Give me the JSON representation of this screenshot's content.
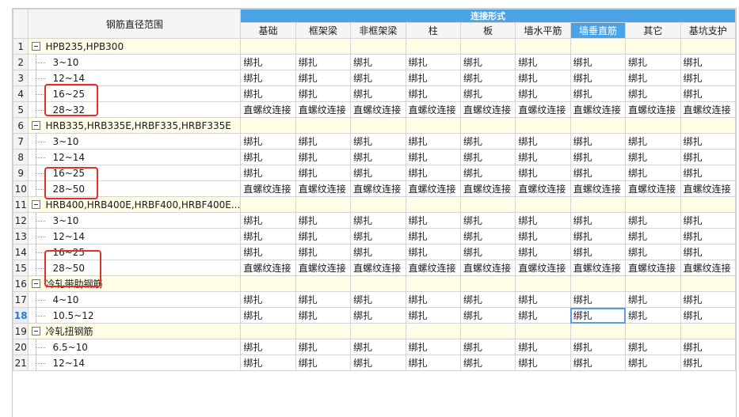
{
  "header": {
    "range_label": "钢筋直径范围",
    "group_label": "连接形式",
    "columns": [
      "基础",
      "框架梁",
      "非框架梁",
      "柱",
      "板",
      "墙水平筋",
      "墙垂直筋",
      "其它",
      "基坑支护"
    ],
    "active_column": "墙垂直筋"
  },
  "rows": [
    {
      "n": "1",
      "type": "group",
      "label": "HPB235,HPB300",
      "vals": [
        "",
        "",
        "",
        "",
        "",
        "",
        "",
        "",
        ""
      ]
    },
    {
      "n": "2",
      "type": "child",
      "label": "3~10",
      "vals": [
        "绑扎",
        "绑扎",
        "绑扎",
        "绑扎",
        "绑扎",
        "绑扎",
        "绑扎",
        "绑扎",
        "绑扎"
      ]
    },
    {
      "n": "3",
      "type": "child",
      "label": "12~14",
      "vals": [
        "绑扎",
        "绑扎",
        "绑扎",
        "绑扎",
        "绑扎",
        "绑扎",
        "绑扎",
        "绑扎",
        "绑扎"
      ]
    },
    {
      "n": "4",
      "type": "child",
      "label": "16~25",
      "vals": [
        "绑扎",
        "绑扎",
        "绑扎",
        "绑扎",
        "绑扎",
        "绑扎",
        "绑扎",
        "绑扎",
        "绑扎"
      ]
    },
    {
      "n": "5",
      "type": "child",
      "label": "28~32",
      "vals": [
        "直螺纹连接",
        "直螺纹连接",
        "直螺纹连接",
        "直螺纹连接",
        "直螺纹连接",
        "直螺纹连接",
        "直螺纹连接",
        "直螺纹连接",
        "直螺纹连接"
      ]
    },
    {
      "n": "6",
      "type": "group",
      "label": "HRB335,HRB335E,HRBF335,HRBF335E",
      "vals": [
        "",
        "",
        "",
        "",
        "",
        "",
        "",
        "",
        ""
      ]
    },
    {
      "n": "7",
      "type": "child",
      "label": "3~10",
      "vals": [
        "绑扎",
        "绑扎",
        "绑扎",
        "绑扎",
        "绑扎",
        "绑扎",
        "绑扎",
        "绑扎",
        "绑扎"
      ]
    },
    {
      "n": "8",
      "type": "child",
      "label": "12~14",
      "vals": [
        "绑扎",
        "绑扎",
        "绑扎",
        "绑扎",
        "绑扎",
        "绑扎",
        "绑扎",
        "绑扎",
        "绑扎"
      ]
    },
    {
      "n": "9",
      "type": "child",
      "label": "16~25",
      "vals": [
        "绑扎",
        "绑扎",
        "绑扎",
        "绑扎",
        "绑扎",
        "绑扎",
        "绑扎",
        "绑扎",
        "绑扎"
      ]
    },
    {
      "n": "10",
      "type": "child",
      "label": "28~50",
      "vals": [
        "直螺纹连接",
        "直螺纹连接",
        "直螺纹连接",
        "直螺纹连接",
        "直螺纹连接",
        "直螺纹连接",
        "直螺纹连接",
        "直螺纹连接",
        "直螺纹连接"
      ]
    },
    {
      "n": "11",
      "type": "group",
      "label": "HRB400,HRB400E,HRBF400,HRBF400E...",
      "vals": [
        "",
        "",
        "",
        "",
        "",
        "",
        "",
        "",
        ""
      ]
    },
    {
      "n": "12",
      "type": "child",
      "label": "3~10",
      "vals": [
        "绑扎",
        "绑扎",
        "绑扎",
        "绑扎",
        "绑扎",
        "绑扎",
        "绑扎",
        "绑扎",
        "绑扎"
      ]
    },
    {
      "n": "13",
      "type": "child",
      "label": "12~14",
      "vals": [
        "绑扎",
        "绑扎",
        "绑扎",
        "绑扎",
        "绑扎",
        "绑扎",
        "绑扎",
        "绑扎",
        "绑扎"
      ]
    },
    {
      "n": "14",
      "type": "child",
      "label": "16~25",
      "vals": [
        "绑扎",
        "绑扎",
        "绑扎",
        "绑扎",
        "绑扎",
        "绑扎",
        "绑扎",
        "绑扎",
        "绑扎"
      ]
    },
    {
      "n": "15",
      "type": "child",
      "label": "28~50",
      "vals": [
        "直螺纹连接",
        "直螺纹连接",
        "直螺纹连接",
        "直螺纹连接",
        "直螺纹连接",
        "直螺纹连接",
        "直螺纹连接",
        "直螺纹连接",
        "直螺纹连接"
      ]
    },
    {
      "n": "16",
      "type": "group",
      "label": "冷轧带肋钢筋",
      "vals": [
        "",
        "",
        "",
        "",
        "",
        "",
        "",
        "",
        ""
      ]
    },
    {
      "n": "17",
      "type": "child",
      "label": "4~10",
      "vals": [
        "绑扎",
        "绑扎",
        "绑扎",
        "绑扎",
        "绑扎",
        "绑扎",
        "绑扎",
        "绑扎",
        "绑扎"
      ]
    },
    {
      "n": "18",
      "type": "child",
      "label": "10.5~12",
      "vals": [
        "绑扎",
        "绑扎",
        "绑扎",
        "绑扎",
        "绑扎",
        "绑扎",
        "绑扎",
        "绑扎",
        "绑扎"
      ]
    },
    {
      "n": "19",
      "type": "group",
      "label": "冷轧扭钢筋",
      "vals": [
        "",
        "",
        "",
        "",
        "",
        "",
        "",
        "",
        ""
      ]
    },
    {
      "n": "20",
      "type": "child",
      "label": "6.5~10",
      "vals": [
        "绑扎",
        "绑扎",
        "绑扎",
        "绑扎",
        "绑扎",
        "绑扎",
        "绑扎",
        "绑扎",
        "绑扎"
      ]
    },
    {
      "n": "21",
      "type": "child",
      "label": "12~14",
      "vals": [
        "绑扎",
        "绑扎",
        "绑扎",
        "绑扎",
        "绑扎",
        "绑扎",
        "绑扎",
        "绑扎",
        "绑扎"
      ]
    }
  ],
  "selected_row": "18",
  "selected_cell": {
    "row": "18",
    "column": "墙垂直筋"
  },
  "highlight_color": "#e0302a",
  "accent_color": "#4aa3e6"
}
